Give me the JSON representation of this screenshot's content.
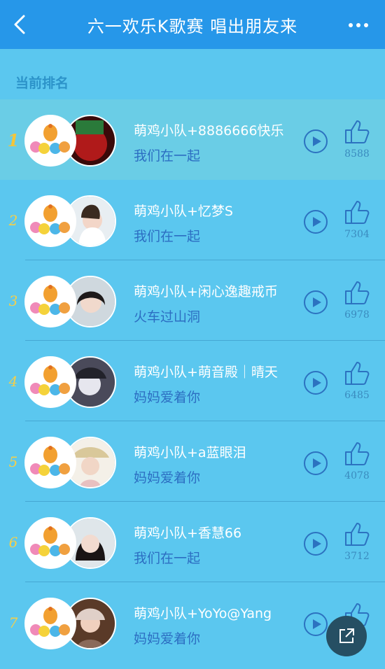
{
  "header": {
    "title": "六一欢乐K歌赛 唱出朋友来"
  },
  "section": {
    "label": "当前排名"
  },
  "ranking": [
    {
      "rank": "1",
      "name": "萌鸡小队+8886666快乐",
      "song": "我们在一起",
      "likes": "8588"
    },
    {
      "rank": "2",
      "name": "萌鸡小队+忆梦S",
      "song": "我们在一起",
      "likes": "7304"
    },
    {
      "rank": "3",
      "name": "萌鸡小队+闲心逸趣戒币",
      "song": "火车过山洞",
      "likes": "6978"
    },
    {
      "rank": "4",
      "name": "萌鸡小队+萌音殿｜晴天",
      "song": "妈妈爱着你",
      "likes": "6485"
    },
    {
      "rank": "5",
      "name": "萌鸡小队+a蓝眼泪",
      "song": "妈妈爱着你",
      "likes": "4078"
    },
    {
      "rank": "6",
      "name": "萌鸡小队+香慧66",
      "song": "我们在一起",
      "likes": "3712"
    },
    {
      "rank": "7",
      "name": "萌鸡小队+YoYo@Yang",
      "song": "妈妈爱着你",
      "likes": ""
    }
  ],
  "colors": {
    "header": "#2697e9",
    "background": "#5bc7ef",
    "rank": "#f5cf4a",
    "song": "#2c6ec2"
  }
}
